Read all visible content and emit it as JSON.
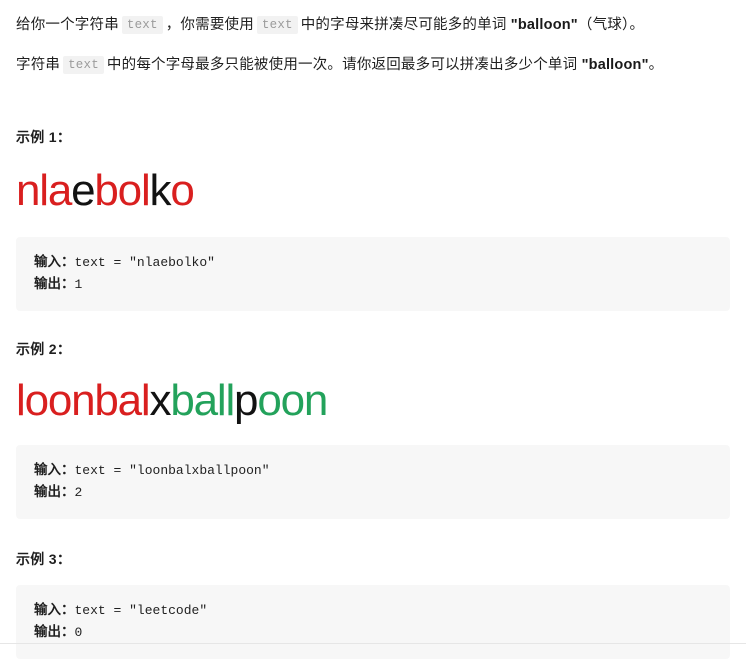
{
  "description": {
    "paragraph1": {
      "part1": "给你一个字符串",
      "code1": "text",
      "part2": "，你需要使用",
      "code2": "text",
      "part3": "中的字母来拼凑尽可能多的单词",
      "bold1": "\"balloon\"",
      "part4": "（气球）",
      "part5": "。"
    },
    "paragraph2": {
      "part1": "字符串",
      "code1": "text",
      "part2": "中的每个字母最多只能被使用一次。请你返回最多可以拼凑出多少个单词",
      "bold1": "\"balloon\"",
      "part3": "。"
    }
  },
  "examples": [
    {
      "heading": "示例 1：",
      "sample_string": "nlaebolko",
      "sample_segments": [
        {
          "text": "nla",
          "color": "#d91f1f"
        },
        {
          "text": "e",
          "color": "#121212"
        },
        {
          "text": "bol",
          "color": "#d91f1f"
        },
        {
          "text": "k",
          "color": "#121212"
        },
        {
          "text": "o",
          "color": "#d91f1f"
        }
      ],
      "input_label": "输入：",
      "input_value": "text = \"nlaebolko\"",
      "output_label": "输出：",
      "output_value": "1"
    },
    {
      "heading": "示例 2：",
      "sample_string": "loonbalxballpoon",
      "sample_segments": [
        {
          "text": "loonbal",
          "color": "#d91f1f"
        },
        {
          "text": "x",
          "color": "#121212"
        },
        {
          "text": "ball",
          "color": "#23a25b"
        },
        {
          "text": "p",
          "color": "#121212"
        },
        {
          "text": "oon",
          "color": "#23a25b"
        }
      ],
      "input_label": "输入：",
      "input_value": "text = \"loonbalxballpoon\"",
      "output_label": "输出：",
      "output_value": "2"
    },
    {
      "heading": "示例 3：",
      "sample_string": "",
      "sample_segments": [],
      "input_label": "输入：",
      "input_value": "text = \"leetcode\"",
      "output_label": "输出：",
      "output_value": "0"
    }
  ],
  "colors": {
    "red": "#d91f1f",
    "green": "#23a25b",
    "black": "#121212",
    "code_background": "#f7f7f7",
    "inline_code_background": "#f2f2f2",
    "inline_code_text": "#9b9b9b",
    "divider": "#e6e6e6"
  }
}
